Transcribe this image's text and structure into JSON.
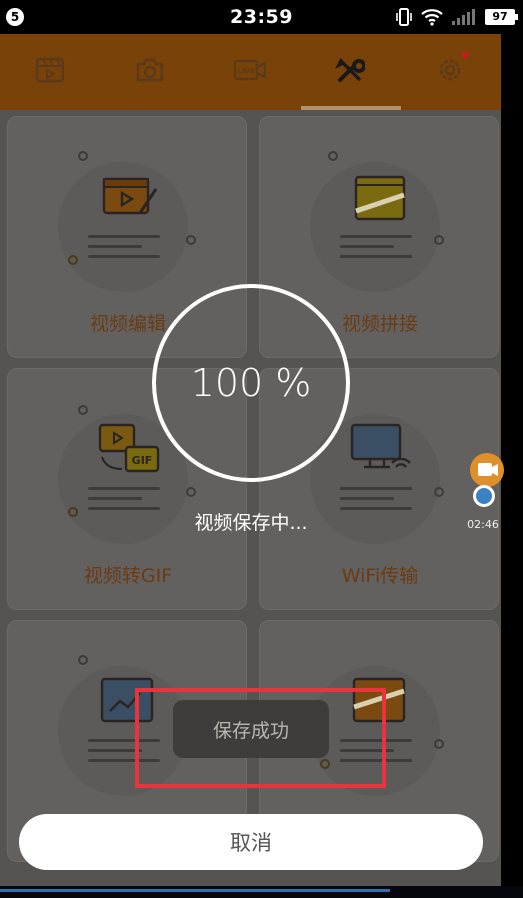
{
  "status_bar": {
    "badge": "5",
    "time": "23:59",
    "battery": "97",
    "icons": [
      "vibrate-icon",
      "wifi-icon",
      "signal-icon",
      "battery-icon"
    ]
  },
  "toolbar": {
    "tabs": [
      {
        "name": "video-edit-tab-icon"
      },
      {
        "name": "camera-tab-icon"
      },
      {
        "name": "live-tab-icon",
        "text": "LIVE"
      },
      {
        "name": "tools-tab-icon",
        "active": true
      },
      {
        "name": "settings-tab-icon",
        "has_badge": true
      }
    ]
  },
  "cards": [
    {
      "label": "视频编辑",
      "icon": "video-edit-icon"
    },
    {
      "label": "视频拼接",
      "icon": "video-merge-icon"
    },
    {
      "label": "视频转GIF",
      "icon": "video-to-gif-icon",
      "icon_text": "GIF"
    },
    {
      "label": "WiFi传输",
      "icon": "wifi-transfer-icon"
    },
    {
      "label": "",
      "icon": "image-chart-icon"
    },
    {
      "label": "",
      "icon": "video-clip-icon"
    }
  ],
  "float_widget": {
    "time": "02:46"
  },
  "progress": {
    "value_text": "100 %",
    "percent": 100
  },
  "status_text": "视频保存中...",
  "toast": {
    "text": "保存成功"
  },
  "cancel_button": {
    "label": "取消"
  },
  "colors": {
    "toolbar": "#784208",
    "accent": "#f08c10",
    "highlight": "#e8343a"
  }
}
